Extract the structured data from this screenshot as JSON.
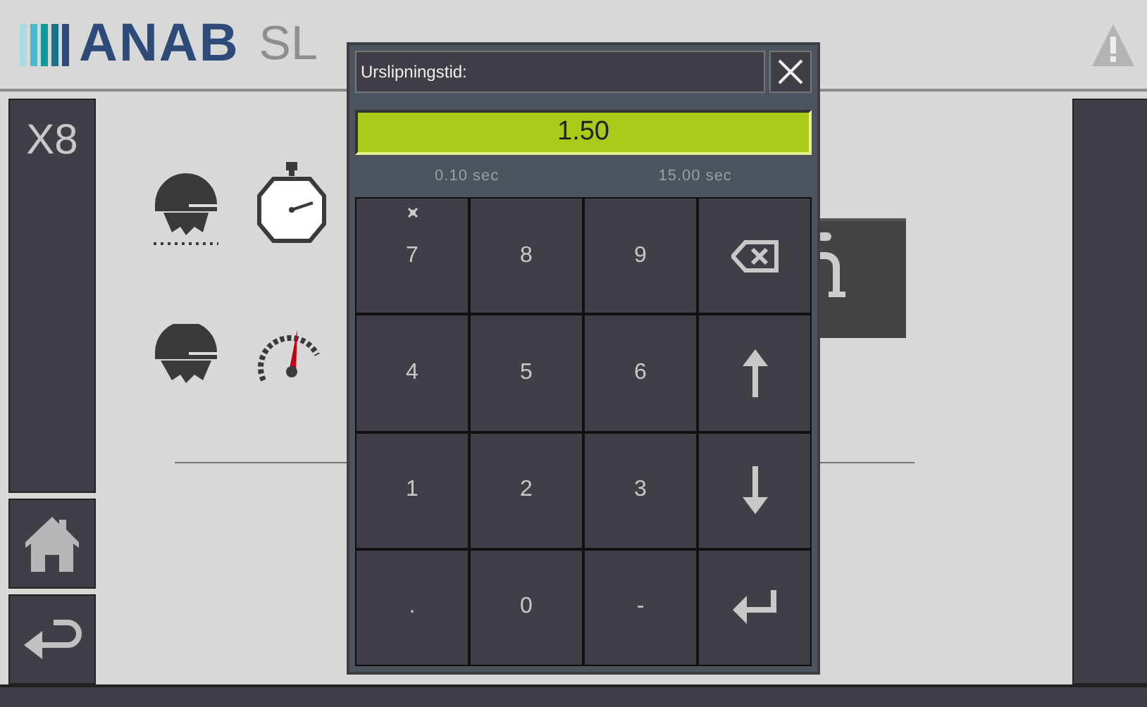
{
  "header": {
    "logo": "ANAB",
    "title": "SL"
  },
  "sidebar": {
    "machine": "X8"
  },
  "dialog": {
    "title": "Urslipningstid:",
    "value": "1.50",
    "min": "0.10 sec",
    "max": "15.00 sec",
    "keys": [
      {
        "kind": "digit",
        "label": "7",
        "marked": true
      },
      {
        "kind": "digit",
        "label": "8",
        "marked": false
      },
      {
        "kind": "digit",
        "label": "9",
        "marked": false
      },
      {
        "kind": "backspace"
      },
      {
        "kind": "digit",
        "label": "4",
        "marked": false
      },
      {
        "kind": "digit",
        "label": "5",
        "marked": false
      },
      {
        "kind": "digit",
        "label": "6",
        "marked": false
      },
      {
        "kind": "up"
      },
      {
        "kind": "digit",
        "label": "1",
        "marked": false
      },
      {
        "kind": "digit",
        "label": "2",
        "marked": false
      },
      {
        "kind": "digit",
        "label": "3",
        "marked": false
      },
      {
        "kind": "down"
      },
      {
        "kind": "digit",
        "label": ".",
        "marked": false
      },
      {
        "kind": "digit",
        "label": "0",
        "marked": false
      },
      {
        "kind": "digit",
        "label": "-",
        "marked": false
      },
      {
        "kind": "enter"
      }
    ]
  }
}
